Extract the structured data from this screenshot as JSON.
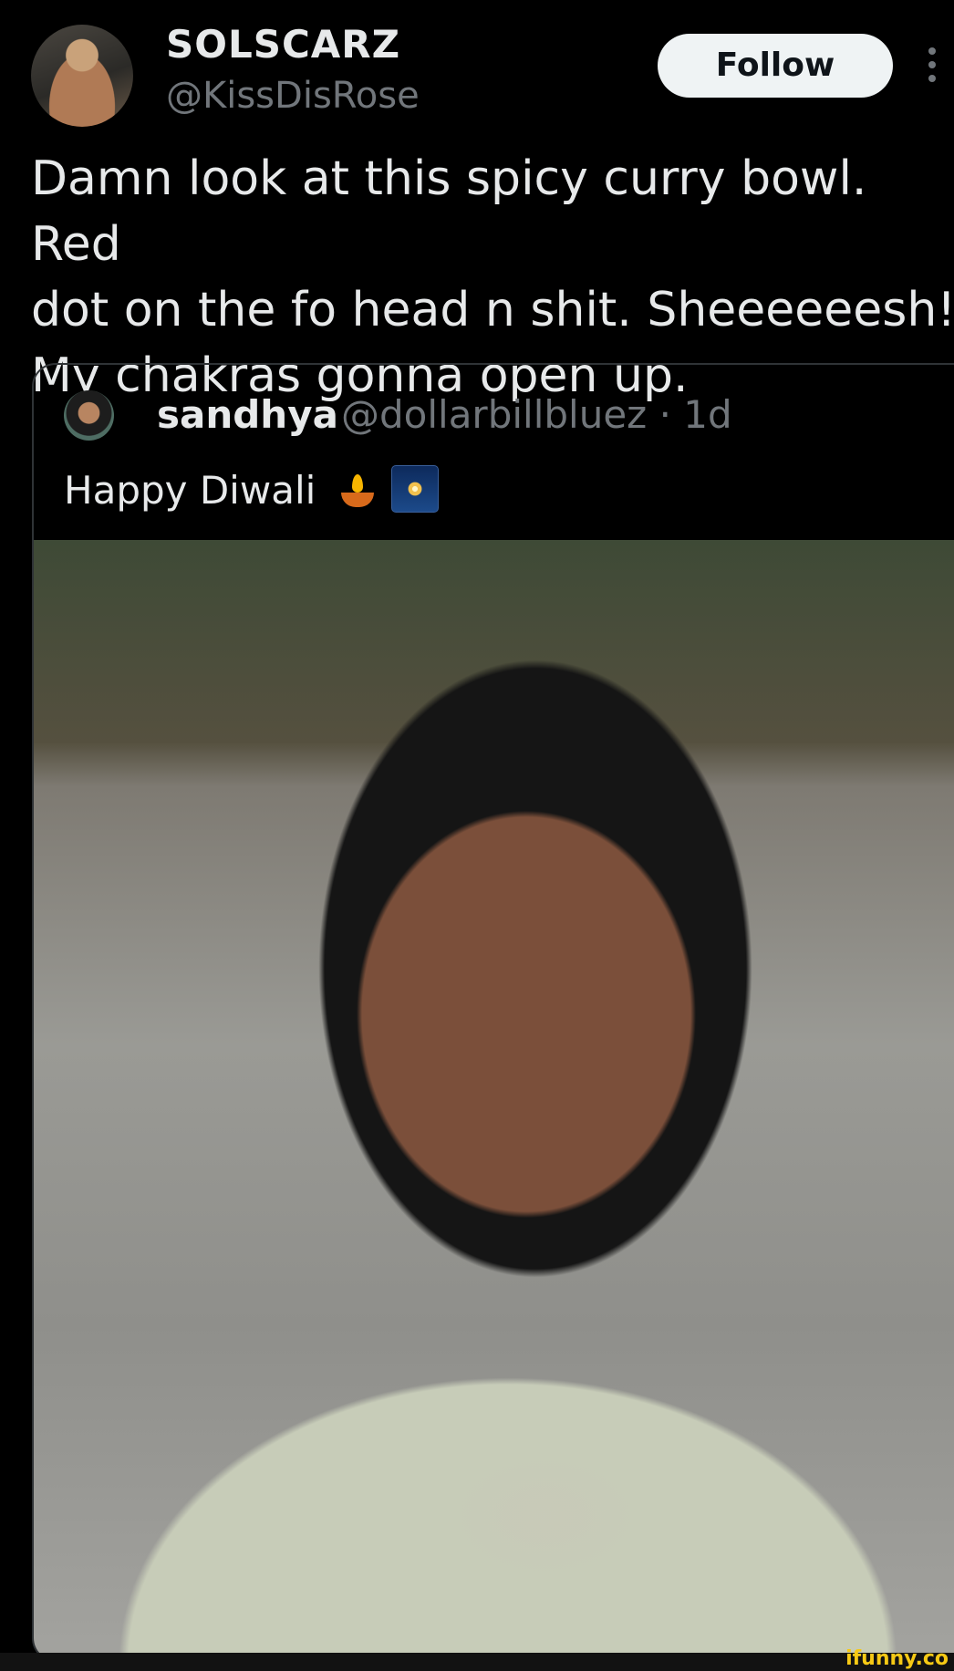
{
  "author": {
    "display_name": "SOLSCARZ",
    "handle": "@KissDisRose",
    "follow_label": "Follow"
  },
  "tweet": {
    "text": "Damn look at this spicy curry bowl. Red\ndot on the fo head n shit. Sheeeeeesh!\nMy chakras gonna open up."
  },
  "quoted_tweet": {
    "display_name": "sandhya",
    "handle": "@dollarbillbluez",
    "separator": "·",
    "time": "1d",
    "text": "Happy Diwali",
    "emojis": [
      "diya-lamp-icon",
      "sparkler-icon"
    ]
  },
  "watermark": "ifunny.co",
  "colors": {
    "background": "#000000",
    "primary_text": "#e7e9ea",
    "secondary_text": "#71767b",
    "follow_button_bg": "#eff3f4",
    "watermark": "#f6c915"
  }
}
